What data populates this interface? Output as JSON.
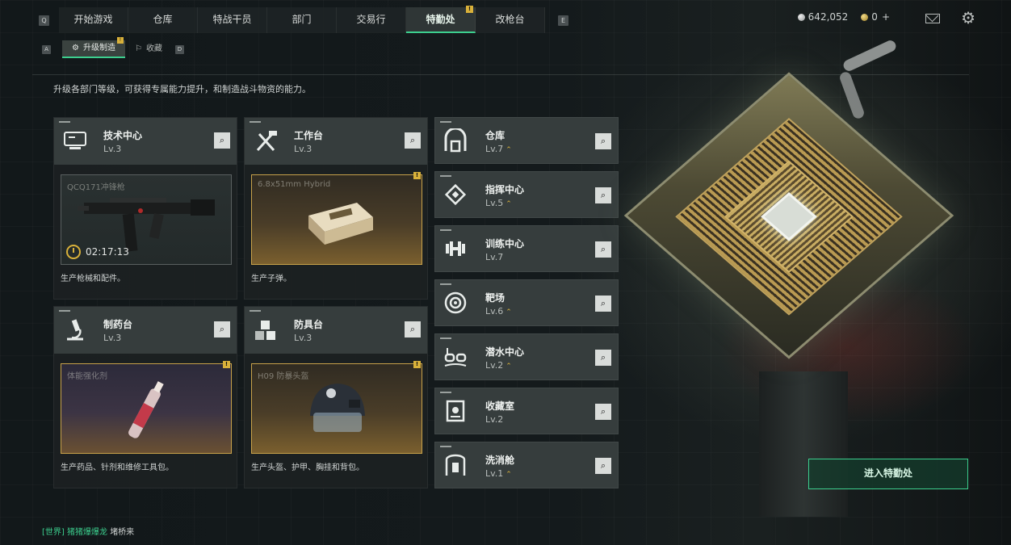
{
  "nav": {
    "key_left": "Q",
    "key_right": "E",
    "tabs": [
      {
        "label": "开始游戏"
      },
      {
        "label": "仓库"
      },
      {
        "label": "特战干员"
      },
      {
        "label": "部门"
      },
      {
        "label": "交易行"
      },
      {
        "label": "特勤处",
        "active": true,
        "badge": "!"
      },
      {
        "label": "改枪台"
      }
    ]
  },
  "currency": {
    "silver": "642,052",
    "gold": "0",
    "plus": "+"
  },
  "subnav": {
    "key_left": "A",
    "key_right": "D",
    "tabs": [
      {
        "label": "升级制造",
        "active": true,
        "badge": "!"
      },
      {
        "label": "收藏"
      }
    ]
  },
  "description": "升级各部门等级，可获得专属能力提升，和制造战斗物资的能力。",
  "cards": [
    {
      "title": "技术中心",
      "level": "Lv.3",
      "item": "QCQ171冲锋枪",
      "timer": "02:17:13",
      "desc": "生产枪械和配件。",
      "icon": "monitor-icon"
    },
    {
      "title": "工作台",
      "level": "Lv.3",
      "item": "6.8x51mm Hybrid",
      "desc": "生产子弹。",
      "badge": "!",
      "icon": "tools-icon"
    },
    {
      "title": "制药台",
      "level": "Lv.3",
      "item": "体能强化剂",
      "desc": "生产药品、针剂和维修工具包。",
      "badge": "!",
      "icon": "microscope-icon"
    },
    {
      "title": "防具台",
      "level": "Lv.3",
      "item": "H09 防暴头盔",
      "desc": "生产头盔、护甲、胸挂和背包。",
      "badge": "!",
      "icon": "cubes-icon"
    }
  ],
  "departments": [
    {
      "title": "仓库",
      "level": "Lv.7",
      "upgradable": true,
      "icon": "warehouse-icon"
    },
    {
      "title": "指挥中心",
      "level": "Lv.5",
      "upgradable": true,
      "icon": "command-icon"
    },
    {
      "title": "训练中心",
      "level": "Lv.7",
      "upgradable": false,
      "icon": "dumbbell-icon"
    },
    {
      "title": "靶场",
      "level": "Lv.6",
      "upgradable": true,
      "icon": "target-icon"
    },
    {
      "title": "潜水中心",
      "level": "Lv.2",
      "upgradable": true,
      "icon": "goggles-icon"
    },
    {
      "title": "收藏室",
      "level": "Lv.2",
      "upgradable": false,
      "icon": "collection-icon"
    },
    {
      "title": "洗消舱",
      "level": "Lv.1",
      "upgradable": true,
      "icon": "decon-icon"
    }
  ],
  "enter_button": "进入特勤处",
  "chat": {
    "channel": "[世界]",
    "user": "猪猪爆爆龙",
    "message": "堵桥来"
  },
  "colors": {
    "accent_green": "#3ccf8e",
    "badge_gold": "#d9b13a"
  }
}
